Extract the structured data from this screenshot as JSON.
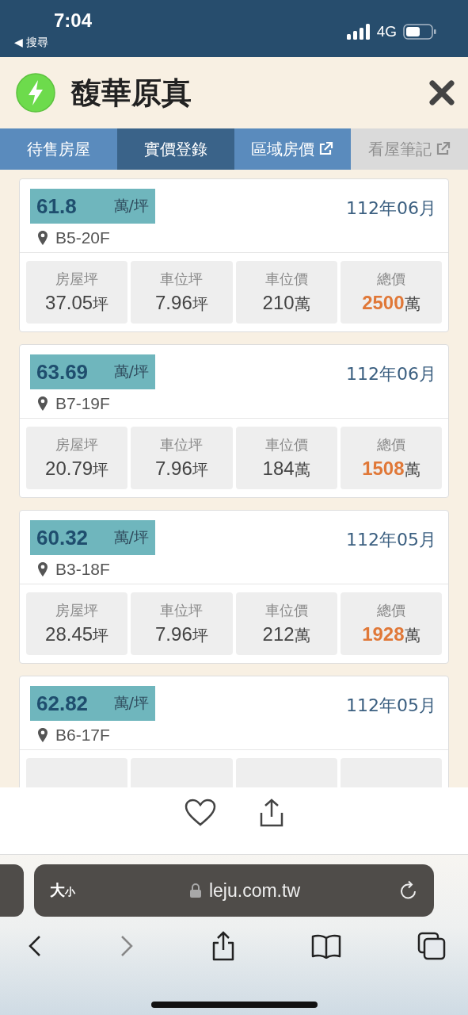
{
  "status_bar": {
    "time": "7:04",
    "back_label": "◀ 搜尋",
    "network": "4G"
  },
  "header": {
    "title": "馥華原真"
  },
  "tabs": [
    {
      "label": "待售房屋",
      "selected": false,
      "disabled": false,
      "external": false
    },
    {
      "label": "實價登錄",
      "selected": true,
      "disabled": false,
      "external": false
    },
    {
      "label": "區域房價",
      "selected": false,
      "disabled": false,
      "external": true
    },
    {
      "label": "看屋筆記",
      "selected": false,
      "disabled": true,
      "external": true
    }
  ],
  "records": [
    {
      "price": "61.8",
      "unit": "萬/坪",
      "date": "112年06月",
      "location": "B5-20F",
      "stats": [
        {
          "label": "房屋坪",
          "value": "37.05",
          "unit": "坪",
          "highlight": false
        },
        {
          "label": "車位坪",
          "value": "7.96",
          "unit": "坪",
          "highlight": false
        },
        {
          "label": "車位價",
          "value": "210",
          "unit": "萬",
          "highlight": false
        },
        {
          "label": "總價",
          "value": "2500",
          "unit": "萬",
          "highlight": true
        }
      ]
    },
    {
      "price": "63.69",
      "unit": "萬/坪",
      "date": "112年06月",
      "location": "B7-19F",
      "stats": [
        {
          "label": "房屋坪",
          "value": "20.79",
          "unit": "坪",
          "highlight": false
        },
        {
          "label": "車位坪",
          "value": "7.96",
          "unit": "坪",
          "highlight": false
        },
        {
          "label": "車位價",
          "value": "184",
          "unit": "萬",
          "highlight": false
        },
        {
          "label": "總價",
          "value": "1508",
          "unit": "萬",
          "highlight": true
        }
      ]
    },
    {
      "price": "60.32",
      "unit": "萬/坪",
      "date": "112年05月",
      "location": "B3-18F",
      "stats": [
        {
          "label": "房屋坪",
          "value": "28.45",
          "unit": "坪",
          "highlight": false
        },
        {
          "label": "車位坪",
          "value": "7.96",
          "unit": "坪",
          "highlight": false
        },
        {
          "label": "車位價",
          "value": "212",
          "unit": "萬",
          "highlight": false
        },
        {
          "label": "總價",
          "value": "1928",
          "unit": "萬",
          "highlight": true
        }
      ]
    },
    {
      "price": "62.82",
      "unit": "萬/坪",
      "date": "112年05月",
      "location": "B6-17F"
    }
  ],
  "browser": {
    "text_size_label": "大",
    "text_size_small": "小",
    "url": "leju.com.tw"
  }
}
